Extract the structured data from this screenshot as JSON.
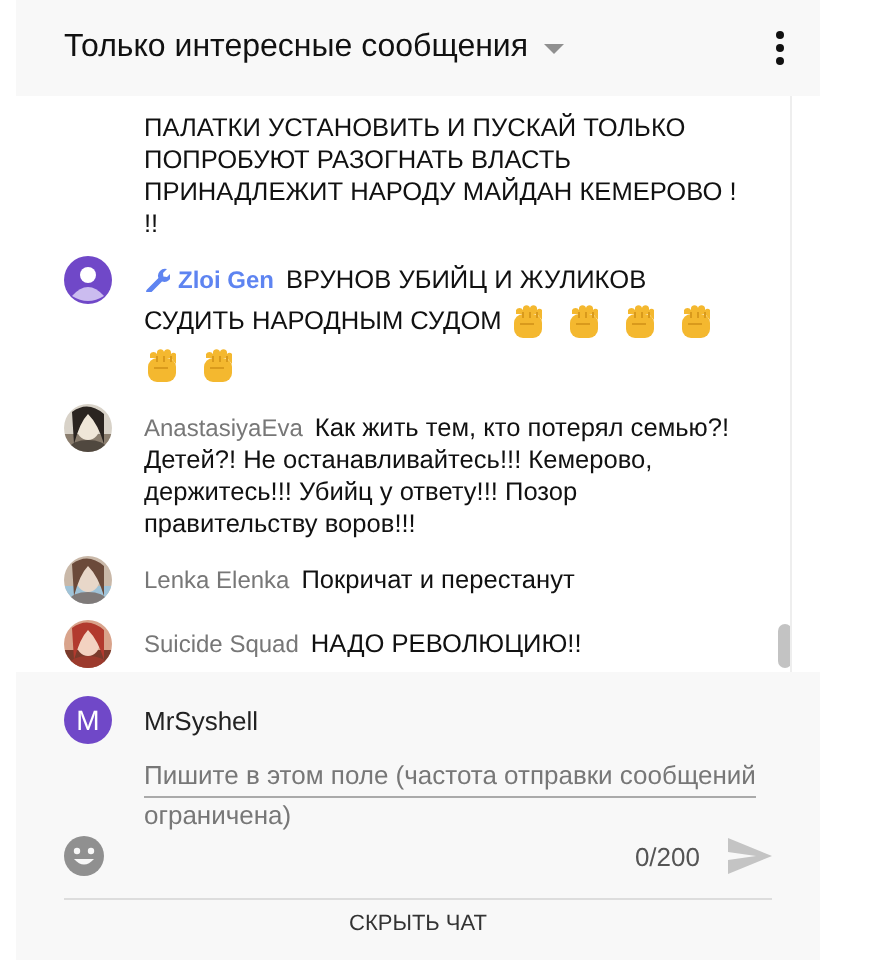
{
  "header": {
    "title": "Только интересные сообщения"
  },
  "messages": [
    {
      "kind": "continuation",
      "text": "ПАЛАТКИ УСТАНОВИТЬ И ПУСКАЙ ТОЛЬКО ПОПРОБУЮТ РАЗОГНАТЬ ВЛАСТЬ ПРИНАДЛЕЖИТ НАРОДУ МАЙДАН КЕМЕРОВО ! !!"
    },
    {
      "kind": "message",
      "author": "Zloi Gen",
      "moderator": true,
      "avatar": {
        "kind": "default"
      },
      "text": "ВРУНОВ УБИЙЦ И ЖУЛИКОВ СУДИТЬ НАРОДНЫМ СУДОМ",
      "emojis": [
        {
          "kind": "raised-fist"
        },
        {
          "kind": "raised-fist"
        },
        {
          "kind": "raised-fist"
        },
        {
          "kind": "raised-fist"
        },
        {
          "kind": "raised-fist"
        },
        {
          "kind": "raised-fist"
        }
      ]
    },
    {
      "kind": "message",
      "author": "AnastasiyaEva",
      "moderator": false,
      "text": "Как жить тем, кто потерял семью?! Детей?! Не останавливайтесь!!! Кемерово, держитесь!!! Убийц у ответу!!! Позор правительству воров!!!"
    },
    {
      "kind": "message",
      "author": "Lenka Elenka",
      "moderator": false,
      "text": "Покричат и перестанут"
    },
    {
      "kind": "message",
      "author": "Suicide Squad",
      "moderator": false,
      "text": "НАДО РЕВОЛЮЦИЮ!!"
    }
  ],
  "composer": {
    "author": "MrSyshell",
    "avatar_letter": "M",
    "placeholder": "Пишите в этом поле (частота отправки сообщений ограничена)",
    "counter": "0/200"
  },
  "footer": {
    "button": "СКРЫТЬ ЧАТ"
  }
}
